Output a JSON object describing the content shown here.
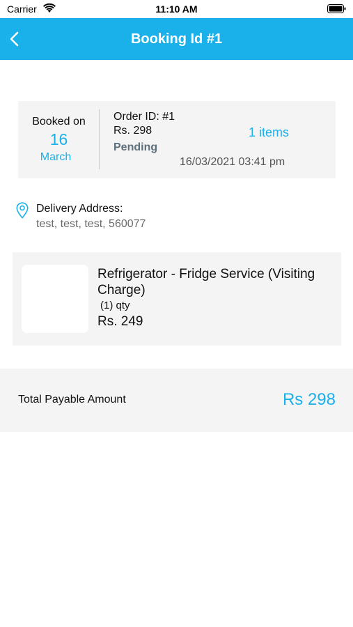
{
  "status_bar": {
    "carrier": "Carrier",
    "time": "11:10 AM"
  },
  "header": {
    "title": "Booking Id #1",
    "back_icon": "chevron-left-icon",
    "background": "#1ab0ea"
  },
  "summary": {
    "booked_label": "Booked on",
    "day": "16",
    "month": "March",
    "order_id": "Order ID: #1",
    "amount": "Rs. 298",
    "status": "Pending",
    "items": "1 items",
    "datetime": "16/03/2021 03:41 pm"
  },
  "delivery": {
    "label": "Delivery Address:",
    "address": "test, test, test, 560077",
    "icon": "location-pin-icon"
  },
  "items": [
    {
      "name": "Refrigerator - Fridge Service (Visiting Charge)",
      "qty": "(1) qty",
      "price": "Rs. 249"
    }
  ],
  "total": {
    "label": "Total Payable Amount",
    "value": "Rs 298"
  },
  "colors": {
    "accent": "#1ab0ea",
    "status": "#5c6f7b",
    "card_background": "#f4f4f4"
  }
}
